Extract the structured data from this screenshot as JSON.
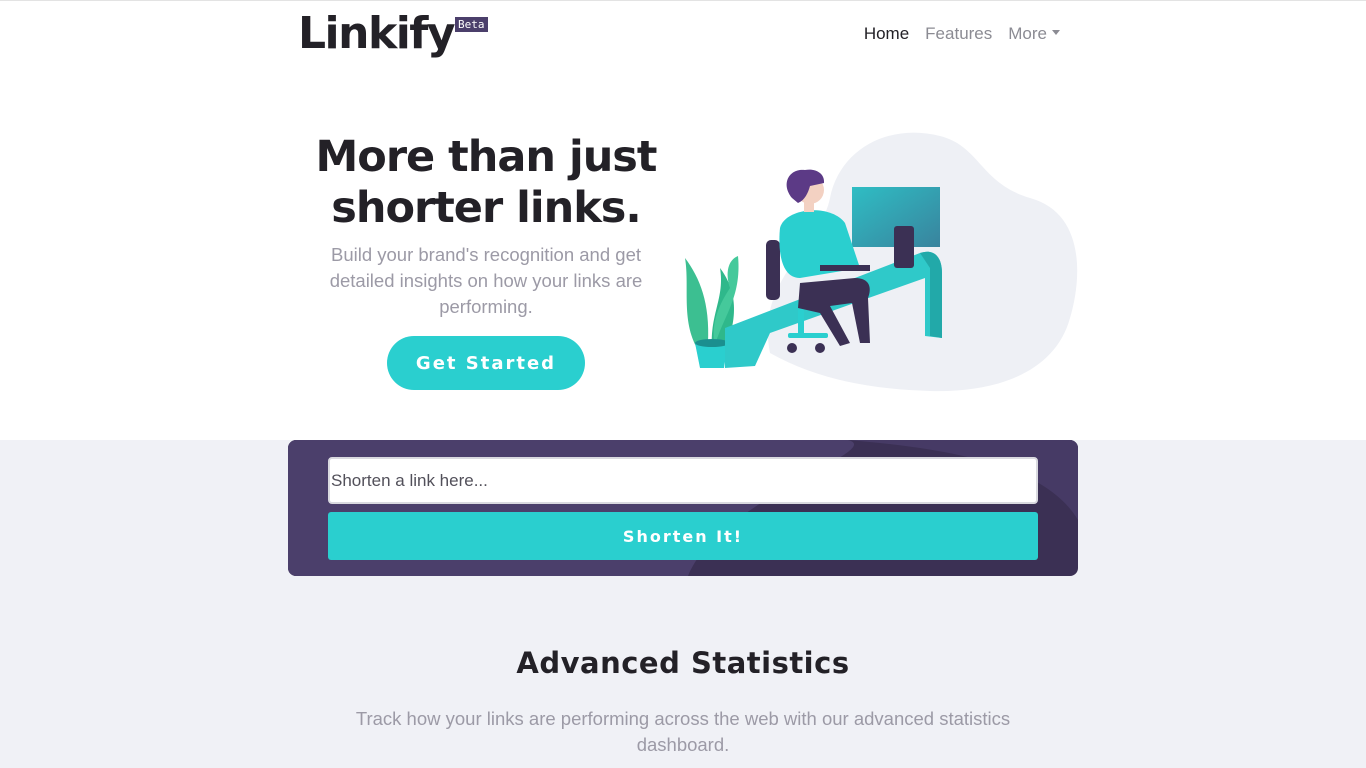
{
  "brand": {
    "name": "Linkify",
    "badge": "Beta"
  },
  "nav": {
    "items": [
      {
        "label": "Home",
        "active": true
      },
      {
        "label": "Features",
        "active": false
      },
      {
        "label": "More",
        "active": false,
        "dropdown": true
      }
    ]
  },
  "hero": {
    "title": "More than just shorter links.",
    "subtitle": "Build your brand's recognition and get detailed insights on how your links are performing.",
    "cta_label": "Get Started",
    "illustration": "person-working-at-desk-illustration"
  },
  "shorten": {
    "placeholder": "Shorten a link here...",
    "value": "",
    "button_label": "Shorten It!"
  },
  "stats": {
    "title": "Advanced Statistics",
    "subtitle": "Track how your links are performing across the web with our advanced statistics dashboard."
  },
  "colors": {
    "accent": "#2acfcf",
    "dark_violet": "#3b3054",
    "text_dark": "#232127",
    "text_gray": "#9c9aa6",
    "page_bg": "#f0f1f6"
  }
}
